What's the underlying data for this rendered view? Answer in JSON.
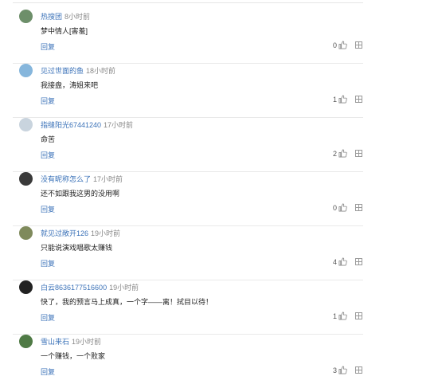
{
  "comments": [
    {
      "user": "热搜团",
      "time": "8小时前",
      "text": "梦中情人[害羞]",
      "reply": "回复",
      "likes": "0",
      "avatar_color": "#6d8f6a"
    },
    {
      "user": "见过世面的鱼",
      "time": "18小时前",
      "text": "我接盘，涛姐来吧",
      "reply": "回复",
      "likes": "1",
      "avatar_color": "#86b6dc"
    },
    {
      "user": "指缝阳光67441240",
      "time": "17小时前",
      "text": "命苦",
      "reply": "回复",
      "likes": "2",
      "avatar_color": "#c9d4de"
    },
    {
      "user": "没有昵称怎么了",
      "time": "17小时前",
      "text": "还不如跟我这男的没用啊",
      "reply": "回复",
      "likes": "0",
      "avatar_color": "#3a3a3a"
    },
    {
      "user": "就见过敞开126",
      "time": "19小时前",
      "text": "只能说演戏唱歌太赚钱",
      "reply": "回复",
      "likes": "4",
      "avatar_color": "#7f8a5c"
    },
    {
      "user": "白云8636177516600",
      "time": "19小时前",
      "text": "快了，我的预言马上成真，一个字——离！拭目以待！",
      "reply": "回复",
      "likes": "1",
      "avatar_color": "#222222"
    },
    {
      "user": "雪山来石",
      "time": "19小时前",
      "text": "一个赚钱，一个败家",
      "reply": "回复",
      "likes": "3",
      "avatar_color": "#4f7a45"
    }
  ],
  "colors": {
    "link": "#3b72b8",
    "time": "#888888",
    "text": "#222222",
    "separator": "#e9e9e9"
  },
  "icons": {
    "like": "thumb-up-icon",
    "report": "report-icon"
  }
}
